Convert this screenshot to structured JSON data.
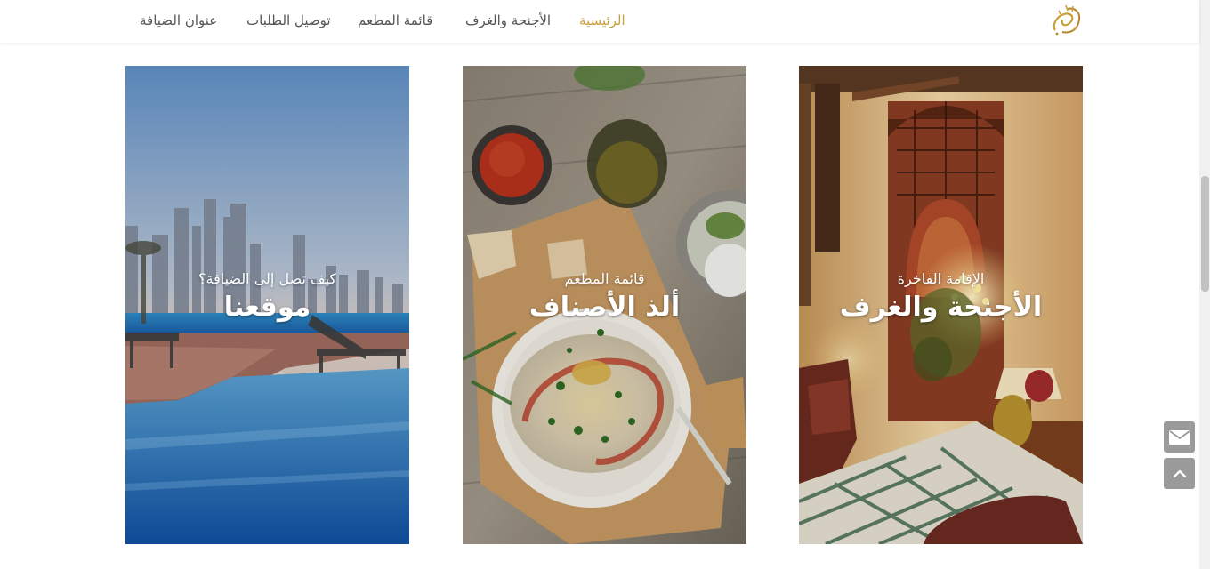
{
  "header": {
    "logo_icon": "arabic-calligraphy-logo-icon",
    "nav": [
      {
        "label": "الرئيسية",
        "active": true
      },
      {
        "label": "الأجنحة والغرف",
        "active": false
      },
      {
        "label": "قائمة المطعم",
        "active": false
      },
      {
        "label": "توصيل الطلبات",
        "active": false
      },
      {
        "label": "عنوان الضيافة",
        "active": false
      }
    ]
  },
  "cards": [
    {
      "subtitle": "الإقامة الفاخرة",
      "title": "الأجنحة والغرف",
      "image": "luxury-hotel-interior"
    },
    {
      "subtitle": "قائمة المطعم",
      "title": "ألذ الأصناف",
      "image": "hummus-plate-food"
    },
    {
      "subtitle": "كيف تصل إلى الضيافة؟",
      "title": "موقعنا",
      "image": "city-pool-skyline"
    }
  ],
  "floating": {
    "mail_icon": "envelope-icon",
    "top_icon": "chevron-up-icon"
  },
  "colors": {
    "accent": "#c9a13a",
    "nav_text": "#555555",
    "fab": "#9a9a9a"
  }
}
